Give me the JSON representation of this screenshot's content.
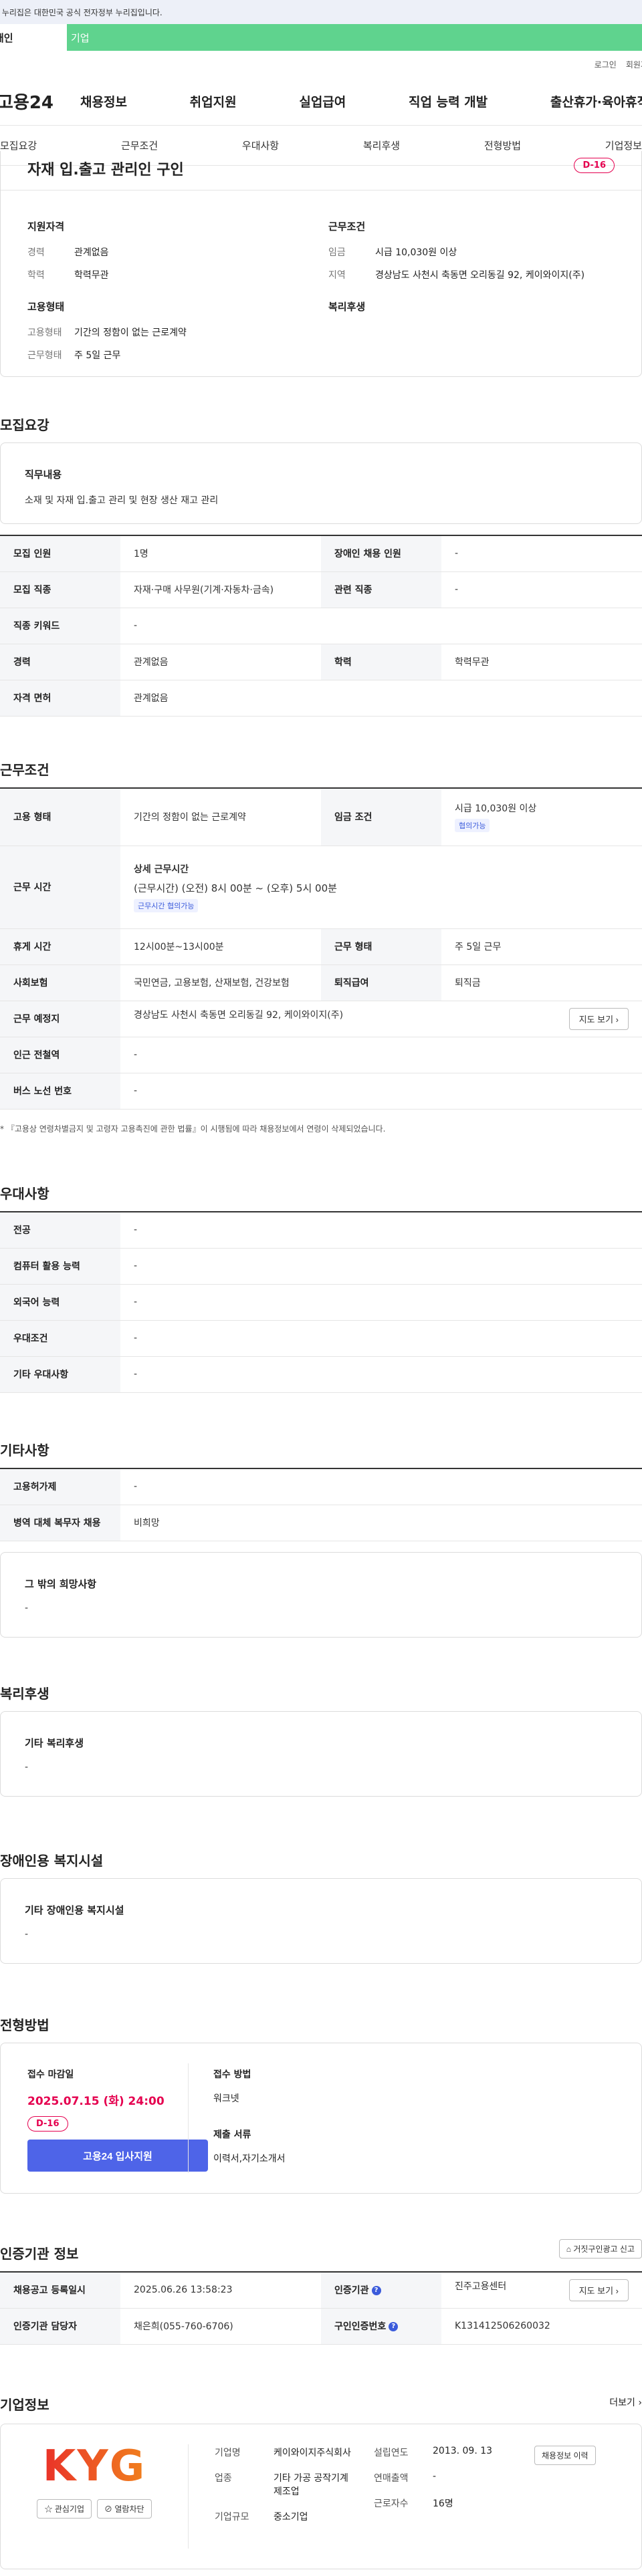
{
  "gov_banner": "이 누리집은 대한민국 공식 전자정부 누리집입니다.",
  "top_tabs": [
    "개인",
    "기업"
  ],
  "util": [
    "로그인",
    "회원가입"
  ],
  "logo": "고용24",
  "gnb": [
    "채용정보",
    "취업지원",
    "실업급여",
    "직업 능력 개발",
    "출산휴가·육아휴직"
  ],
  "subnav": [
    "모집요강",
    "근무조건",
    "우대사항",
    "복리후생",
    "전형방법",
    "기업정보"
  ],
  "summary": {
    "title": "자재 입.출고 관리인 구인",
    "dday": "D-16",
    "qual_title": "지원자격",
    "qual": [
      {
        "k": "경력",
        "v": "관계없음"
      },
      {
        "k": "학력",
        "v": "학력무관"
      }
    ],
    "cond_title": "근무조건",
    "cond": [
      {
        "k": "임금",
        "v": "시급 10,030원 이상"
      },
      {
        "k": "지역",
        "v": "경상남도 사천시 축동면 오리동길 92, 케이와이지(주)"
      }
    ],
    "emp_title": "고용형태",
    "emp": [
      {
        "k": "고용형태",
        "v": "기간의 정함이 없는 근로계약"
      },
      {
        "k": "근무형태",
        "v": "주 5일 근무"
      }
    ],
    "welfare_title": "복리후생"
  },
  "recruit": {
    "title": "모집요강",
    "duty_title": "직무내용",
    "duty": "소재 및 자재 입.출고 관리 및 현장 생산 재고 관리",
    "rows": [
      {
        "h1": "모집 인원",
        "v1": "1명",
        "h2": "장애인 채용 인원",
        "v2": "-"
      },
      {
        "h1": "모집 직종",
        "v1": "자재·구매 사무원(기계·자동차·금속)",
        "h2": "관련 직종",
        "v2": "-"
      },
      {
        "h1": "직종 키워드",
        "v1": "-"
      },
      {
        "h1": "경력",
        "v1": "관계없음",
        "h2": "학력",
        "v2": "학력무관"
      },
      {
        "h1": "자격 면허",
        "v1": "관계없음"
      }
    ]
  },
  "work": {
    "title": "근무조건",
    "emp_type_h": "고용 형태",
    "emp_type": "기간의 정함이 없는 근로계약",
    "wage_h": "임금 조건",
    "wage": "시급 10,030원 이상",
    "wage_tag": "협의가능",
    "hours_h": "근무 시간",
    "hours_sub": "상세 근무시간",
    "hours": "(근무시간) (오전) 8시 00분 ~ (오후) 5시 00분",
    "hours_tag": "근무시간 협의가능",
    "break_h": "휴게 시간",
    "break": "12시00분~13시00분",
    "form_h": "근무 형태",
    "form": "주 5일 근무",
    "ins_h": "사회보험",
    "ins": "국민연금, 고용보험, 산재보험, 건강보험",
    "retire_h": "퇴직급여",
    "retire": "퇴직금",
    "place_h": "근무 예정지",
    "place": "경상남도 사천시 축동면 오리동길 92, 케이와이지(주)",
    "map_btn": "지도 보기",
    "subway_h": "인근 전철역",
    "subway": "-",
    "bus_h": "버스 노선 번호",
    "bus": "-",
    "note": "* 『고용상 연령차별금지 및 고령자 고용촉진에 관한 법률』이 시행됨에 따라 채용정보에서 연령이 삭제되었습니다."
  },
  "pref": {
    "title": "우대사항",
    "rows": [
      {
        "h": "전공",
        "v": "-"
      },
      {
        "h": "컴퓨터 활용 능력",
        "v": "-"
      },
      {
        "h": "외국어 능력",
        "v": "-"
      },
      {
        "h": "우대조건",
        "v": "-"
      },
      {
        "h": "기타 우대사항",
        "v": "-"
      }
    ]
  },
  "etc": {
    "title": "기타사항",
    "rows": [
      {
        "h": "고용허가제",
        "v": "-"
      },
      {
        "h": "병역 대체 복무자 채용",
        "v": "비희망"
      }
    ],
    "hope_title": "그 밖의 희망사항",
    "hope": "-"
  },
  "welfare": {
    "title": "복리후생",
    "box_title": "기타 복리후생",
    "box_value": "-"
  },
  "disabled": {
    "title": "장애인용 복지시설",
    "box_title": "기타 장애인용 복지시설",
    "box_value": "-"
  },
  "selection": {
    "title": "전형방법",
    "deadline_label": "접수 마감일",
    "deadline": "2025.07.15 (화) 24:00",
    "dday": "D-16",
    "apply_btn": "고용24 입사지원",
    "method_label": "접수 방법",
    "method": "워크넷",
    "docs_label": "제출 서류",
    "docs": "이력서,자기소개서"
  },
  "agency": {
    "title": "인증기관 정보",
    "report_btn": "거짓구인광고 신고",
    "reg_date_h": "채용공고 등록일시",
    "reg_date": "2025.06.26 13:58:23",
    "agency_h": "인증기관",
    "agency": "진주고용센터",
    "map_btn": "지도 보기",
    "manager_h": "인증기관 담당자",
    "manager": "채은희(055-760-6706)",
    "auth_h": "구인인증번호",
    "auth": "K131412506260032"
  },
  "company": {
    "title": "기업정보",
    "more": "더보기",
    "logo_text": "KYG",
    "interest_btn": "관심기업",
    "block_btn": "열람차단",
    "name_h": "기업명",
    "name": "케이와이지주식회사",
    "industry_h": "업종",
    "industry": "기타 가공 공작기계 제조업",
    "scale_h": "기업규모",
    "scale": "중소기업",
    "founded_h": "설립연도",
    "founded": "2013. 09. 13",
    "sales_h": "연매출액",
    "sales": "-",
    "workers_h": "근로자수",
    "workers": "16명",
    "jobs_btn": "채용정보 이력"
  },
  "colors": {
    "accent": "#4e64e8",
    "dday": "#e5004f",
    "tab_green": "#5fd38e"
  }
}
